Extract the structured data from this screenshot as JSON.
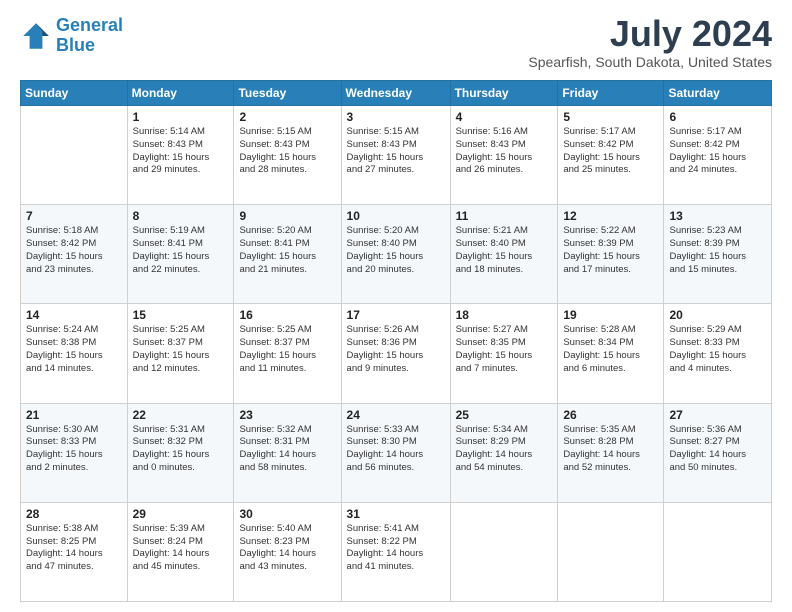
{
  "header": {
    "logo_line1": "General",
    "logo_line2": "Blue",
    "month_title": "July 2024",
    "subtitle": "Spearfish, South Dakota, United States"
  },
  "days_of_week": [
    "Sunday",
    "Monday",
    "Tuesday",
    "Wednesday",
    "Thursday",
    "Friday",
    "Saturday"
  ],
  "weeks": [
    [
      {
        "day": "",
        "info": ""
      },
      {
        "day": "1",
        "info": "Sunrise: 5:14 AM\nSunset: 8:43 PM\nDaylight: 15 hours\nand 29 minutes."
      },
      {
        "day": "2",
        "info": "Sunrise: 5:15 AM\nSunset: 8:43 PM\nDaylight: 15 hours\nand 28 minutes."
      },
      {
        "day": "3",
        "info": "Sunrise: 5:15 AM\nSunset: 8:43 PM\nDaylight: 15 hours\nand 27 minutes."
      },
      {
        "day": "4",
        "info": "Sunrise: 5:16 AM\nSunset: 8:43 PM\nDaylight: 15 hours\nand 26 minutes."
      },
      {
        "day": "5",
        "info": "Sunrise: 5:17 AM\nSunset: 8:42 PM\nDaylight: 15 hours\nand 25 minutes."
      },
      {
        "day": "6",
        "info": "Sunrise: 5:17 AM\nSunset: 8:42 PM\nDaylight: 15 hours\nand 24 minutes."
      }
    ],
    [
      {
        "day": "7",
        "info": "Sunrise: 5:18 AM\nSunset: 8:42 PM\nDaylight: 15 hours\nand 23 minutes."
      },
      {
        "day": "8",
        "info": "Sunrise: 5:19 AM\nSunset: 8:41 PM\nDaylight: 15 hours\nand 22 minutes."
      },
      {
        "day": "9",
        "info": "Sunrise: 5:20 AM\nSunset: 8:41 PM\nDaylight: 15 hours\nand 21 minutes."
      },
      {
        "day": "10",
        "info": "Sunrise: 5:20 AM\nSunset: 8:40 PM\nDaylight: 15 hours\nand 20 minutes."
      },
      {
        "day": "11",
        "info": "Sunrise: 5:21 AM\nSunset: 8:40 PM\nDaylight: 15 hours\nand 18 minutes."
      },
      {
        "day": "12",
        "info": "Sunrise: 5:22 AM\nSunset: 8:39 PM\nDaylight: 15 hours\nand 17 minutes."
      },
      {
        "day": "13",
        "info": "Sunrise: 5:23 AM\nSunset: 8:39 PM\nDaylight: 15 hours\nand 15 minutes."
      }
    ],
    [
      {
        "day": "14",
        "info": "Sunrise: 5:24 AM\nSunset: 8:38 PM\nDaylight: 15 hours\nand 14 minutes."
      },
      {
        "day": "15",
        "info": "Sunrise: 5:25 AM\nSunset: 8:37 PM\nDaylight: 15 hours\nand 12 minutes."
      },
      {
        "day": "16",
        "info": "Sunrise: 5:25 AM\nSunset: 8:37 PM\nDaylight: 15 hours\nand 11 minutes."
      },
      {
        "day": "17",
        "info": "Sunrise: 5:26 AM\nSunset: 8:36 PM\nDaylight: 15 hours\nand 9 minutes."
      },
      {
        "day": "18",
        "info": "Sunrise: 5:27 AM\nSunset: 8:35 PM\nDaylight: 15 hours\nand 7 minutes."
      },
      {
        "day": "19",
        "info": "Sunrise: 5:28 AM\nSunset: 8:34 PM\nDaylight: 15 hours\nand 6 minutes."
      },
      {
        "day": "20",
        "info": "Sunrise: 5:29 AM\nSunset: 8:33 PM\nDaylight: 15 hours\nand 4 minutes."
      }
    ],
    [
      {
        "day": "21",
        "info": "Sunrise: 5:30 AM\nSunset: 8:33 PM\nDaylight: 15 hours\nand 2 minutes."
      },
      {
        "day": "22",
        "info": "Sunrise: 5:31 AM\nSunset: 8:32 PM\nDaylight: 15 hours\nand 0 minutes."
      },
      {
        "day": "23",
        "info": "Sunrise: 5:32 AM\nSunset: 8:31 PM\nDaylight: 14 hours\nand 58 minutes."
      },
      {
        "day": "24",
        "info": "Sunrise: 5:33 AM\nSunset: 8:30 PM\nDaylight: 14 hours\nand 56 minutes."
      },
      {
        "day": "25",
        "info": "Sunrise: 5:34 AM\nSunset: 8:29 PM\nDaylight: 14 hours\nand 54 minutes."
      },
      {
        "day": "26",
        "info": "Sunrise: 5:35 AM\nSunset: 8:28 PM\nDaylight: 14 hours\nand 52 minutes."
      },
      {
        "day": "27",
        "info": "Sunrise: 5:36 AM\nSunset: 8:27 PM\nDaylight: 14 hours\nand 50 minutes."
      }
    ],
    [
      {
        "day": "28",
        "info": "Sunrise: 5:38 AM\nSunset: 8:25 PM\nDaylight: 14 hours\nand 47 minutes."
      },
      {
        "day": "29",
        "info": "Sunrise: 5:39 AM\nSunset: 8:24 PM\nDaylight: 14 hours\nand 45 minutes."
      },
      {
        "day": "30",
        "info": "Sunrise: 5:40 AM\nSunset: 8:23 PM\nDaylight: 14 hours\nand 43 minutes."
      },
      {
        "day": "31",
        "info": "Sunrise: 5:41 AM\nSunset: 8:22 PM\nDaylight: 14 hours\nand 41 minutes."
      },
      {
        "day": "",
        "info": ""
      },
      {
        "day": "",
        "info": ""
      },
      {
        "day": "",
        "info": ""
      }
    ]
  ]
}
